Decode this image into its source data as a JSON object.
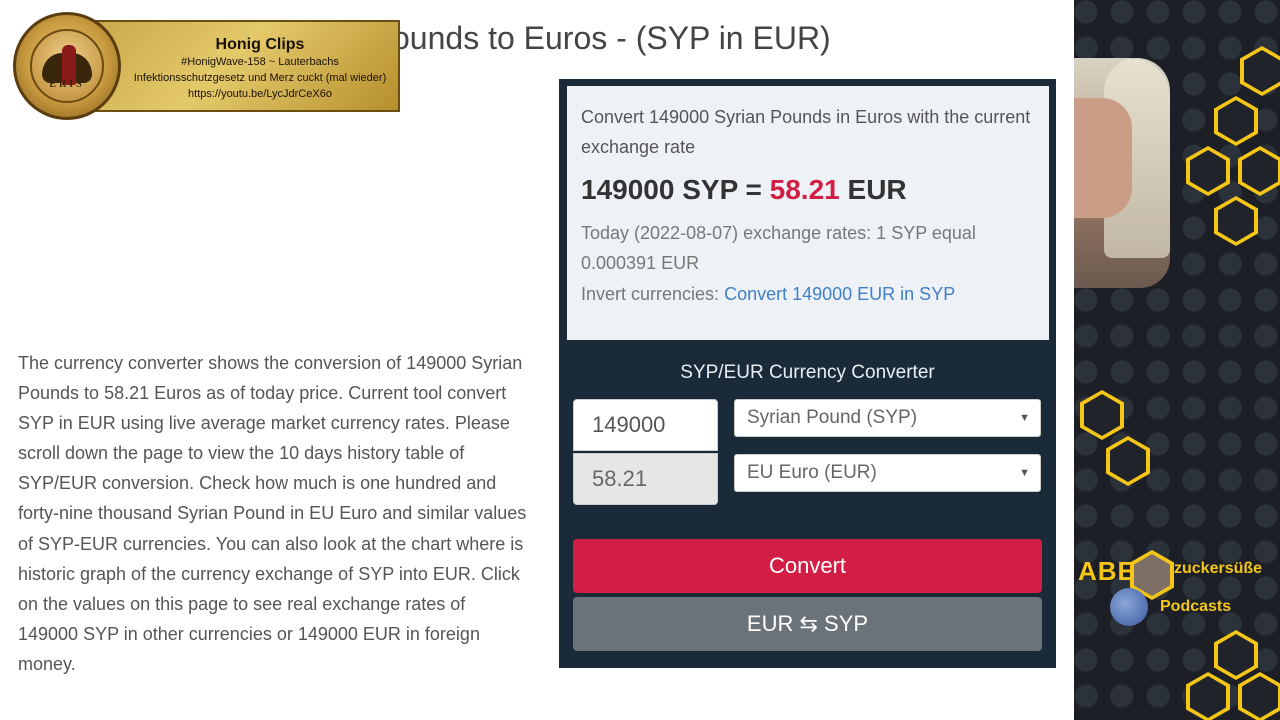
{
  "page": {
    "title": "Syrian Pounds to Euros - (SYP in EUR)",
    "title_visible": "ounds to Euros - (SYP in EUR)"
  },
  "description": "The currency converter shows the conversion of 149000 Syrian Pounds to 58.21 Euros as of today price. Current tool convert SYP in EUR using live average market currency rates. Please scroll down the page to view the 10 days history table of SYP/EUR conversion. Check how much is one hundred and forty-nine thousand Syrian Pound in EU Euro and similar values of SYP-EUR currencies. You can also look at the chart where is historic graph of the currency exchange of SYP into EUR. Click on the values on this page to see real exchange rates of 149000 SYP in other currencies or 149000 EUR in foreign money.",
  "result": {
    "intro": "Convert 149000 Syrian Pounds in Euros with the current exchange rate",
    "from_part": "149000 SYP =",
    "amount": "58.21",
    "to_code": "EUR",
    "rate_text": "Today (2022-08-07) exchange rates: 1 SYP equal 0.000391 EUR",
    "invert_label": "Invert currencies:",
    "invert_link": "Convert 149000 EUR in SYP"
  },
  "converter": {
    "title": "SYP/EUR Currency Converter",
    "input_value": "149000",
    "output_value": "58.21",
    "from_currency": "Syrian Pound (SYP)",
    "to_currency": "EU Euro (EUR)",
    "convert_label": "Convert",
    "swap_label": "EUR ⇆ SYP"
  },
  "overlay": {
    "title": "Honig Clips",
    "line1": "#HonigWave-158 ~ Lauterbachs",
    "line2": "Infektionsschutzgesetz und Merz cuckt (mal wieder)",
    "line3": "https://youtu.be/LycJdrCeX6o",
    "logo_text": "ERIS"
  },
  "stream_brand": {
    "abe": "ABE",
    "zucker": "zuckersüße",
    "podcasts": "Podcasts",
    "accent": "#f5c518"
  },
  "colors": {
    "accent_red": "#d21e45",
    "panel_dark": "#1a2a38",
    "link_blue": "#3f7fc8",
    "swap_gray": "#6a7379"
  },
  "icons": {
    "select_arrow": "chevron-down-icon",
    "swap": "swap-arrows-icon"
  }
}
